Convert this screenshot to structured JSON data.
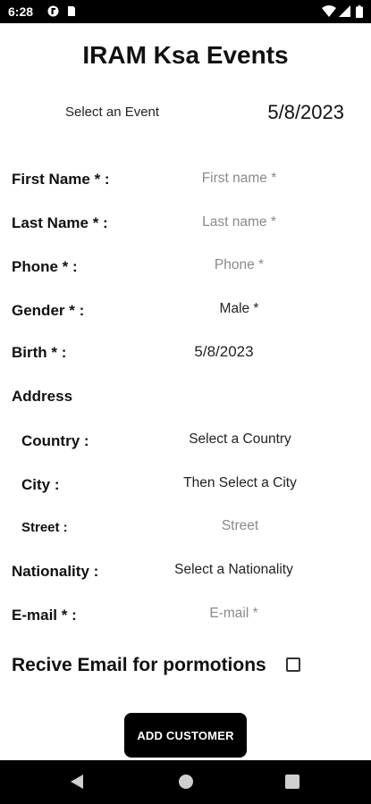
{
  "status_bar": {
    "time": "6:28",
    "icons": [
      "notification-circle-icon",
      "sim-card-icon",
      "wifi-icon",
      "signal-icon",
      "battery-icon"
    ]
  },
  "app": {
    "title": "IRAM Ksa Events"
  },
  "event": {
    "select_label": "Select an Event",
    "date": "5/8/2023"
  },
  "form": {
    "first_name": {
      "label": "First Name * :",
      "placeholder": "First name *"
    },
    "last_name": {
      "label": "Last Name * :",
      "placeholder": "Last name *"
    },
    "phone": {
      "label": "Phone * :",
      "placeholder": "Phone *"
    },
    "gender": {
      "label": "Gender * :",
      "value": "Male *"
    },
    "birth": {
      "label": "Birth * :",
      "value": "5/8/2023"
    },
    "address": {
      "heading": "Address",
      "country": {
        "label": "Country :",
        "value": "Select a Country"
      },
      "city": {
        "label": "City :",
        "value": "Then Select a City"
      },
      "street": {
        "label": "Street :",
        "placeholder": "Street"
      }
    },
    "nationality": {
      "label": "Nationality :",
      "value": "Select a Nationality"
    },
    "email": {
      "label": "E-mail * :",
      "placeholder": "E-mail *"
    },
    "promotions": {
      "label": "Recive Email for pormotions",
      "checked": false
    }
  },
  "actions": {
    "add_customer": "ADD CUSTOMER"
  },
  "colors": {
    "button_bg": "#000000",
    "placeholder": "#8a8a8a"
  }
}
